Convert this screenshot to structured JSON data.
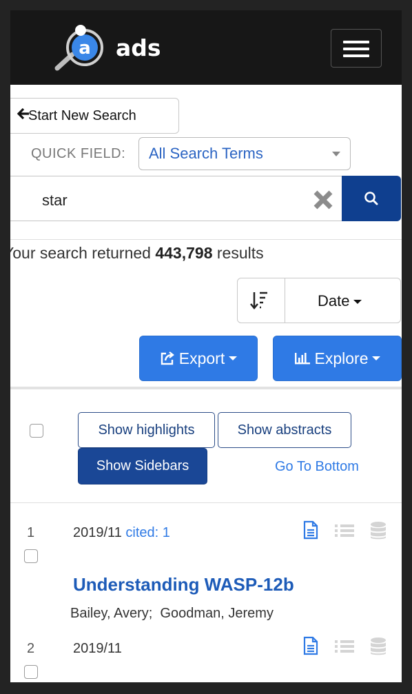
{
  "header": {
    "brand": "ads",
    "logo_letter": "a"
  },
  "search": {
    "start_new_label": "Start New Search",
    "quick_field_label": "QUICK FIELD:",
    "quick_field_value": "All Search Terms",
    "query": "star"
  },
  "results_summary": {
    "prefix": "Your search returned ",
    "count": "443,798",
    "suffix": " results"
  },
  "sort": {
    "field": "Date"
  },
  "actions": {
    "export_label": "Export",
    "explore_label": "Explore"
  },
  "toolbar": {
    "show_highlights": "Show highlights",
    "show_abstracts": "Show abstracts",
    "show_sidebars": "Show Sidebars",
    "go_to_bottom": "Go To Bottom"
  },
  "results": [
    {
      "index": "1",
      "date": "2019/11",
      "cited": "cited: 1",
      "title": "Understanding WASP-12b",
      "authors": "Bailey, Avery;  Goodman, Jeremy"
    },
    {
      "index": "2",
      "date": "2019/11"
    }
  ],
  "colors": {
    "primary": "#2f7ae5",
    "dark_blue": "#1a4796",
    "search_blue": "#0f3f8f",
    "link": "#1d5bb8"
  },
  "icons": [
    "logo-icon",
    "hamburger-icon",
    "arrow-left-icon",
    "chevron-down-icon",
    "close-icon",
    "search-icon",
    "sort-icon",
    "share-icon",
    "bar-chart-icon",
    "document-icon",
    "list-icon",
    "database-icon"
  ]
}
